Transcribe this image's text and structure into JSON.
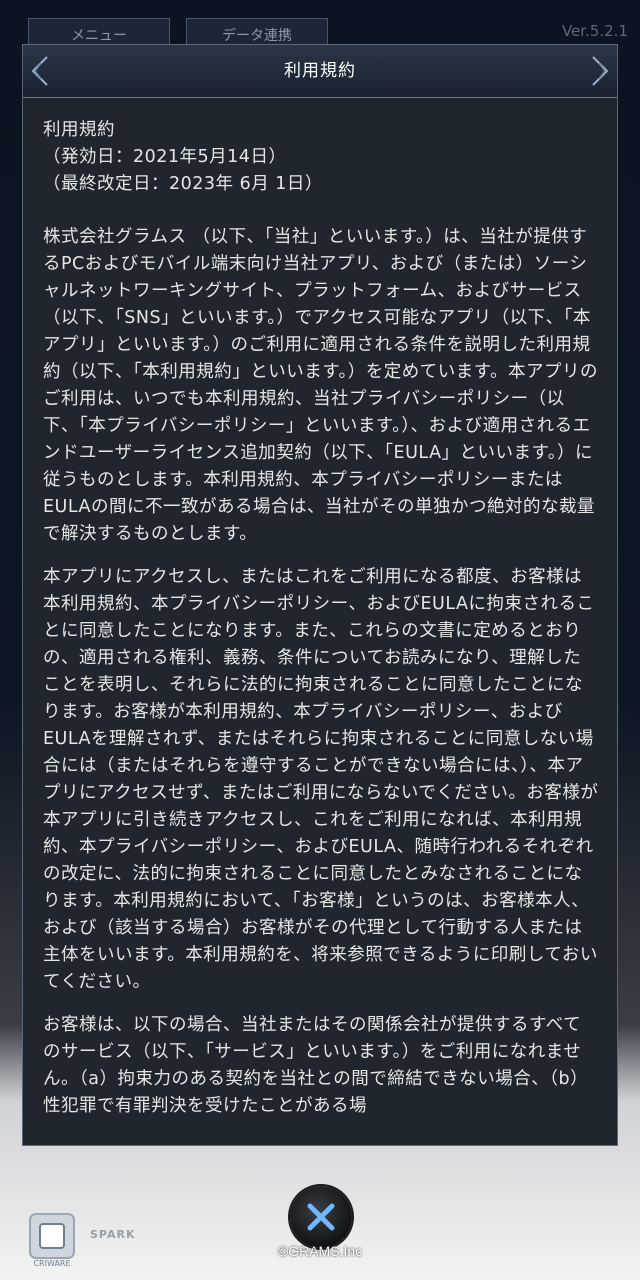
{
  "background": {
    "tabs": [
      "メニュー",
      "データ連携"
    ],
    "version": "Ver.5.2.1"
  },
  "dialog": {
    "title": "利用規約",
    "paragraphs": [
      "利用規約\n（発効日：2021年5月14日）\n（最終改定日：2023年 6月 1日）",
      "株式会社グラムス （以下、「当社」といいます。）は、当社が提供するPCおよびモバイル端末向け当社アプリ、および（または）ソーシャルネットワーキングサイト、プラットフォーム、およびサービス（以下、「SNS」といいます。）でアクセス可能なアプリ（以下、「本アプリ」といいます。）のご利用に適用される条件を説明した利用規約（以下、「本利用規約」といいます。）を定めています。本アプリのご利用は、いつでも本利用規約、当社プライバシーポリシー（以下、「本プライバシーポリシー」といいます。）、および適用されるエンドユーザーライセンス追加契約（以下、「EULA」といいます。）に従うものとします。本利用規約、本プライバシーポリシーまたはEULAの間に不一致がある場合は、当社がその単独かつ絶対的な裁量で解決するものとします。",
      "本アプリにアクセスし、またはこれをご利用になる都度、お客様は本利用規約、本プライバシーポリシー、およびEULAに拘束されることに同意したことになります。また、これらの文書に定めるとおりの、適用される権利、義務、条件についてお読みになり、理解したことを表明し、それらに法的に拘束されることに同意したことになります。お客様が本利用規約、本プライバシーポリシー、およびEULAを理解されず、またはそれらに拘束されることに同意しない場合には（またはそれらを遵守することができない場合には、）、本アプリにアクセスせず、またはご利用にならないでください。お客様が本アプリに引き続きアクセスし、これをご利用になれば、本利用規約、本プライバシーポリシー、およびEULA、随時行われるそれぞれの改定に、法的に拘束されることに同意したとみなされることになります。本利用規約において、「お客様」というのは、お客様本人、および（該当する場合）お客様がその代理として行動する人または主体をいいます。本利用規約を、将来参照できるように印刷しておいてください。",
      "お客様は、以下の場合、当社またはその関係会社が提供するすべてのサービス（以下、「サービス」といいます。）をご利用になれません。（a）拘束力のある契約を当社との間で締結できない場合、（b）性犯罪で有罪判決を受けたことがある場"
    ]
  },
  "footer": {
    "logo_left": "CRIWARE",
    "logo_right": "SPARK",
    "close_icon": "close-x-icon",
    "copyright": "©GRAMS.Inc"
  },
  "colors": {
    "dialog_bg": "#20262e",
    "accent_blue": "#5ab0ff"
  }
}
